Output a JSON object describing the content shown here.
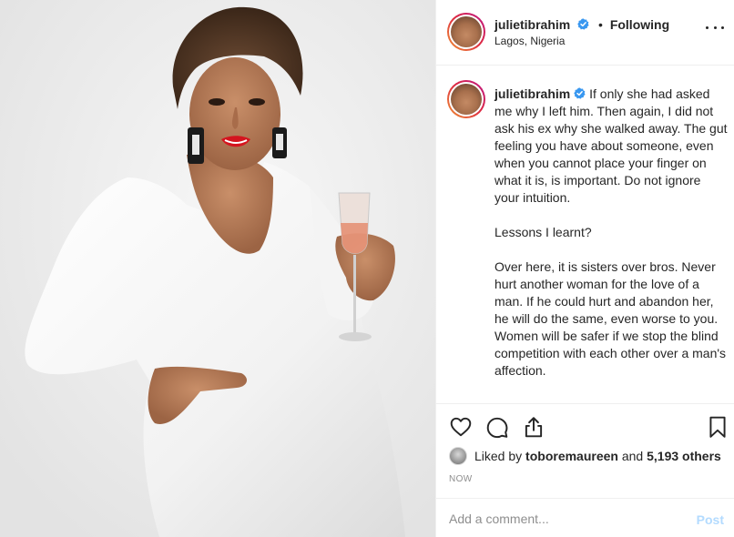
{
  "post": {
    "username": "julietibrahim",
    "follow_status": "Following",
    "separator": "•",
    "location": "Lagos, Nigeria",
    "caption_text": "If only she had asked me why I left him. Then again, I did not ask his ex why she walked away. The gut feeling you have about someone, even when you cannot place your finger on what it is, is important. Do not ignore your intuition.\n\nLessons I learnt?\n\nOver here, it is sisters over bros. Never hurt another woman for the love of a man. If he could hurt and abandon her, he will do the same, even worse to you. Women will be safer if we stop the blind competition with each other over a man's affection.",
    "likes": {
      "prefix": "Liked by",
      "liker": "toboremaureen",
      "joiner": "and",
      "others": "5,193 others"
    },
    "timestamp": "NOW",
    "comment_placeholder": "Add a comment...",
    "post_label": "Post"
  },
  "colors": {
    "verified_blue": "#3897f0",
    "post_button_disabled": "#b3dbff",
    "text": "#262626",
    "muted": "#8e8e8e",
    "lipstick": "#d4141e"
  },
  "icons": [
    "more-options-icon",
    "heart-icon",
    "comment-icon",
    "share-icon",
    "bookmark-icon",
    "verified-badge-icon"
  ]
}
